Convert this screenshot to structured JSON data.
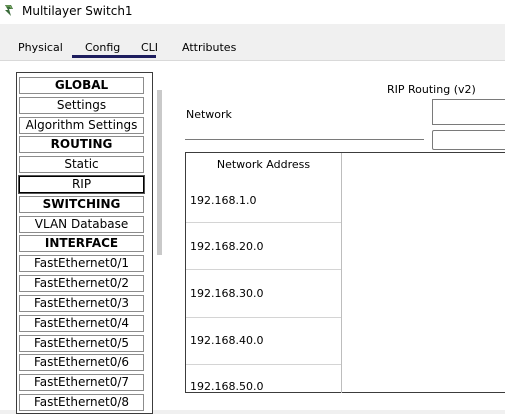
{
  "window": {
    "title": "Multilayer Switch1"
  },
  "tabs": [
    "Physical",
    "Config",
    "CLI",
    "Attributes"
  ],
  "sidebar": {
    "items": [
      {
        "label": "GLOBAL",
        "header": true
      },
      {
        "label": "Settings"
      },
      {
        "label": "Algorithm Settings"
      },
      {
        "label": "ROUTING",
        "header": true
      },
      {
        "label": "Static"
      },
      {
        "label": "RIP",
        "selected": true
      },
      {
        "label": "SWITCHING",
        "header": true
      },
      {
        "label": "VLAN Database"
      },
      {
        "label": "INTERFACE",
        "header": true
      },
      {
        "label": "FastEthernet0/1"
      },
      {
        "label": "FastEthernet0/2"
      },
      {
        "label": "FastEthernet0/3"
      },
      {
        "label": "FastEthernet0/4"
      },
      {
        "label": "FastEthernet0/5"
      },
      {
        "label": "FastEthernet0/6"
      },
      {
        "label": "FastEthernet0/7"
      },
      {
        "label": "FastEthernet0/8"
      }
    ]
  },
  "rip": {
    "title": "RIP Routing (v2)",
    "network_label": "Network",
    "network_value": "",
    "table": {
      "header": "Network Address",
      "rows": [
        "192.168.1.0",
        "192.168.20.0",
        "192.168.30.0",
        "192.168.40.0",
        "192.168.50.0"
      ]
    }
  }
}
